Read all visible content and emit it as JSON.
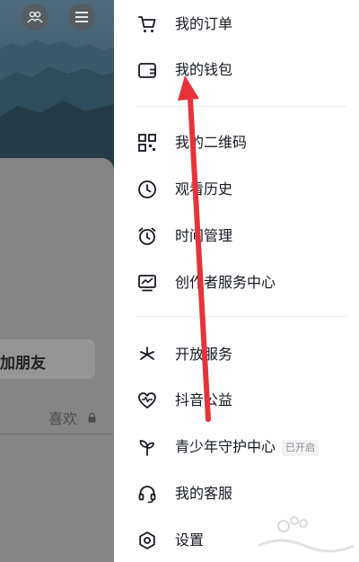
{
  "left_panel": {
    "add_friend_label": "加朋友",
    "like_label": "喜欢"
  },
  "menu": {
    "section1": [
      {
        "icon": "cart-icon",
        "label": "我的订单"
      },
      {
        "icon": "wallet-icon",
        "label": "我的钱包"
      }
    ],
    "section2": [
      {
        "icon": "qrcode-icon",
        "label": "我的二维码"
      },
      {
        "icon": "clock-icon",
        "label": "观看历史"
      },
      {
        "icon": "alarm-icon",
        "label": "时间管理"
      },
      {
        "icon": "creator-chart-icon",
        "label": "创作者服务中心"
      }
    ],
    "section3": [
      {
        "icon": "sparkle-icon",
        "label": "开放服务"
      },
      {
        "icon": "heart-icon",
        "label": "抖音公益"
      },
      {
        "icon": "sprout-icon",
        "label": "青少年守护中心",
        "badge": "已开启"
      },
      {
        "icon": "headset-icon",
        "label": "我的客服"
      },
      {
        "icon": "settings-icon",
        "label": "设置"
      }
    ]
  },
  "annotation": {
    "arrow_color": "#e8323a"
  }
}
